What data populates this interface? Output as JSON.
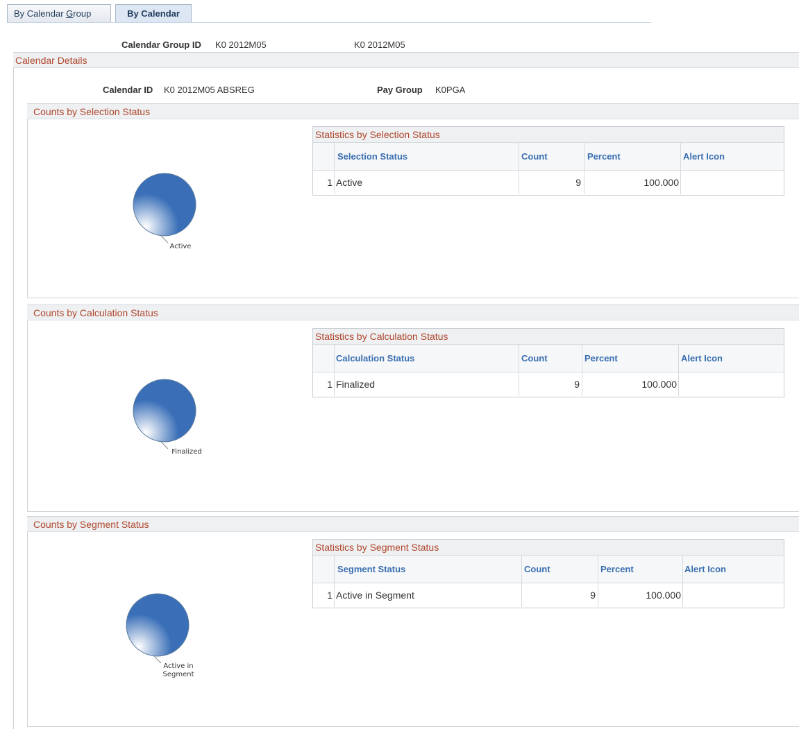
{
  "tabs": [
    {
      "label_pre": "By Calendar ",
      "label_key": "G",
      "label_post": "roup"
    },
    {
      "label": "By Calendar"
    }
  ],
  "header": {
    "calendar_group_label": "Calendar Group ID",
    "calendar_group_value": "K0 2012M05",
    "calendar_group_desc": "K0 2012M05"
  },
  "calendar_details": {
    "title": "Calendar Details",
    "calendar_id_label": "Calendar ID",
    "calendar_id_value": "K0 2012M05 ABSREG",
    "pay_group_label": "Pay Group",
    "pay_group_value": "K0PGA"
  },
  "sections": [
    {
      "title": "Counts by Selection Status",
      "grid_title": "Statistics by Selection Status",
      "columns": [
        "Selection Status",
        "Count",
        "Percent",
        "Alert Icon"
      ],
      "rows": [
        {
          "num": "1",
          "status": "Active",
          "count": "9",
          "percent": "100.000",
          "alert": ""
        }
      ],
      "pie_label": "Active",
      "pie_label_line2": ""
    },
    {
      "title": "Counts by Calculation Status",
      "grid_title": "Statistics by Calculation Status",
      "columns": [
        "Calculation Status",
        "Count",
        "Percent",
        "Alert Icon"
      ],
      "rows": [
        {
          "num": "1",
          "status": "Finalized",
          "count": "9",
          "percent": "100.000",
          "alert": ""
        }
      ],
      "pie_label": "Finalized",
      "pie_label_line2": ""
    },
    {
      "title": "Counts by Segment Status",
      "grid_title": "Statistics by Segment Status",
      "columns": [
        "Segment Status",
        "Count",
        "Percent",
        "Alert Icon"
      ],
      "rows": [
        {
          "num": "1",
          "status": "Active in Segment",
          "count": "9",
          "percent": "100.000",
          "alert": ""
        }
      ],
      "pie_label": "Active in",
      "pie_label_line2": "Segment"
    }
  ],
  "chart_data": [
    {
      "type": "pie",
      "categories": [
        "Active"
      ],
      "values": [
        9
      ],
      "color": "#3a6fb8"
    },
    {
      "type": "pie",
      "categories": [
        "Finalized"
      ],
      "values": [
        9
      ],
      "color": "#3a6fb8"
    },
    {
      "type": "pie",
      "categories": [
        "Active in Segment"
      ],
      "values": [
        9
      ],
      "color": "#3a6fb8"
    }
  ]
}
